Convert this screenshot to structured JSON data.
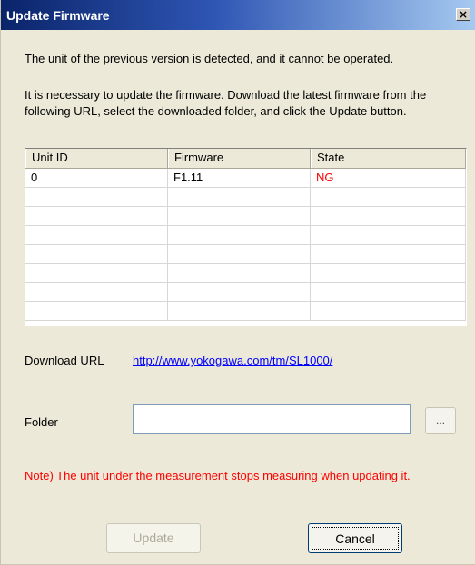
{
  "dialog": {
    "title": "Update Firmware",
    "close_glyph": "×",
    "message1": "The unit of the previous version is detected, and it cannot be operated.",
    "message2": "It is necessary to update the firmware. Download the latest firmware from the following URL, select the downloaded folder, and click the Update button."
  },
  "table": {
    "headers": [
      "Unit ID",
      "Firmware",
      "State"
    ],
    "rows": [
      {
        "unit_id": "0",
        "firmware": "F1.11",
        "state": "NG"
      }
    ]
  },
  "download": {
    "label": "Download URL",
    "url": "http://www.yokogawa.com/tm/SL1000/"
  },
  "folder": {
    "label": "Folder",
    "value": "",
    "browse_label": "..."
  },
  "note": "Note) The unit under the measurement stops measuring when updating it.",
  "buttons": {
    "update": "Update",
    "cancel": "Cancel"
  },
  "colors": {
    "title_bar": "#0a246a",
    "state_ng": "#ff0000",
    "note": "#ff0000",
    "link": "#0000ff"
  },
  "icons": {
    "close": "close-icon"
  }
}
